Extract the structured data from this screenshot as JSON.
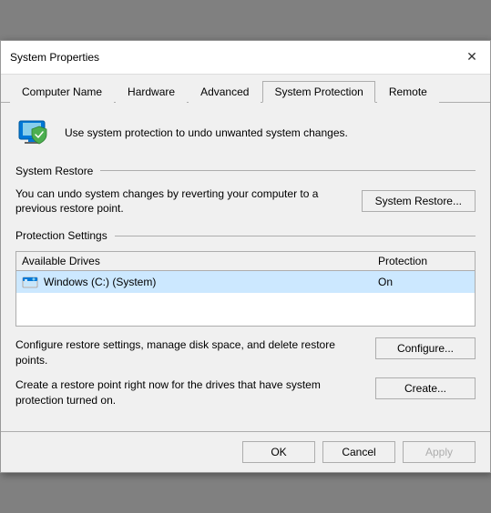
{
  "titleBar": {
    "title": "System Properties",
    "closeIcon": "✕"
  },
  "tabs": [
    {
      "id": "computer-name",
      "label": "Computer Name",
      "active": false
    },
    {
      "id": "hardware",
      "label": "Hardware",
      "active": false
    },
    {
      "id": "advanced",
      "label": "Advanced",
      "active": false
    },
    {
      "id": "system-protection",
      "label": "System Protection",
      "active": true
    },
    {
      "id": "remote",
      "label": "Remote",
      "active": false
    }
  ],
  "infoBanner": {
    "text": "Use system protection to undo unwanted system changes."
  },
  "systemRestore": {
    "sectionTitle": "System Restore",
    "description": "You can undo system changes by reverting your computer to a previous restore point.",
    "buttonLabel": "System Restore..."
  },
  "protectionSettings": {
    "sectionTitle": "Protection Settings",
    "tableHeaders": {
      "drives": "Available Drives",
      "protection": "Protection"
    },
    "drives": [
      {
        "name": "Windows (C:) (System)",
        "protection": "On"
      }
    ]
  },
  "configure": {
    "description": "Configure restore settings, manage disk space, and delete restore points.",
    "buttonLabel": "Configure..."
  },
  "create": {
    "description": "Create a restore point right now for the drives that have system protection turned on.",
    "buttonLabel": "Create..."
  },
  "footer": {
    "okLabel": "OK",
    "cancelLabel": "Cancel",
    "applyLabel": "Apply"
  }
}
